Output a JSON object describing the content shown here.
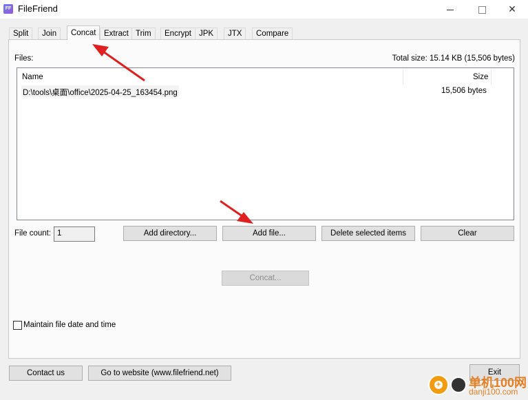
{
  "window": {
    "app_icon_text": "FF",
    "title": "FileFriend",
    "min_label": "",
    "max_label": "",
    "close_label": "✕"
  },
  "tabs": [
    {
      "label": "Split"
    },
    {
      "label": "Join"
    },
    {
      "label": "Concat",
      "active": true
    },
    {
      "label": "Extract"
    },
    {
      "label": "Trim"
    },
    {
      "label": "Encrypt"
    },
    {
      "label": "JPK"
    },
    {
      "label": "JTX"
    },
    {
      "label": "Compare"
    }
  ],
  "concat": {
    "files_label": "Files:",
    "total_size": "Total size: 15.14 KB (15,506 bytes)",
    "columns": {
      "name": "Name",
      "size": "Size"
    },
    "rows": [
      {
        "name": "D:\\tools\\桌面\\office\\2025-04-25_163454.png",
        "size": "15,506 bytes"
      }
    ],
    "file_count_label": "File count:",
    "file_count_value": "1",
    "buttons": {
      "add_directory": "Add directory...",
      "add_file": "Add file...",
      "delete_selected": "Delete selected items",
      "clear": "Clear",
      "concat": "Concat..."
    },
    "maintain_label": "Maintain file date and time",
    "maintain_checked": false
  },
  "footer": {
    "contact": "Contact us",
    "website": "Go to website (www.filefriend.net)",
    "exit": "Exit"
  },
  "watermark": {
    "name": "单机100网",
    "url": "danji100.com"
  },
  "colors": {
    "annotation_arrow": "#e02020",
    "watermark": "#e67e22"
  }
}
